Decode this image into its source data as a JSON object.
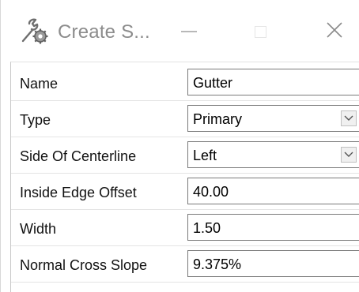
{
  "window": {
    "title": "Create S...",
    "icon": "gear-wrench-icon",
    "minimize_icon": "minimize-icon",
    "maximize_icon": "maximize-icon",
    "close_icon": "close-icon",
    "close_glyph": "✕"
  },
  "properties": [
    {
      "label": "Name",
      "value": "Gutter",
      "control": "textbox"
    },
    {
      "label": "Type",
      "value": "Primary",
      "control": "dropdown"
    },
    {
      "label": "Side Of Centerline",
      "value": "Left",
      "control": "dropdown"
    },
    {
      "label": "Inside Edge Offset",
      "value": "40.00",
      "control": "textbox"
    },
    {
      "label": "Width",
      "value": "1.50",
      "control": "textbox"
    },
    {
      "label": "Normal Cross Slope",
      "value": "9.375%",
      "control": "textbox"
    }
  ],
  "colors": {
    "title_text": "#8c8c8c",
    "field_border": "#7a7a7a",
    "row_separator": "#e4e4e4"
  }
}
